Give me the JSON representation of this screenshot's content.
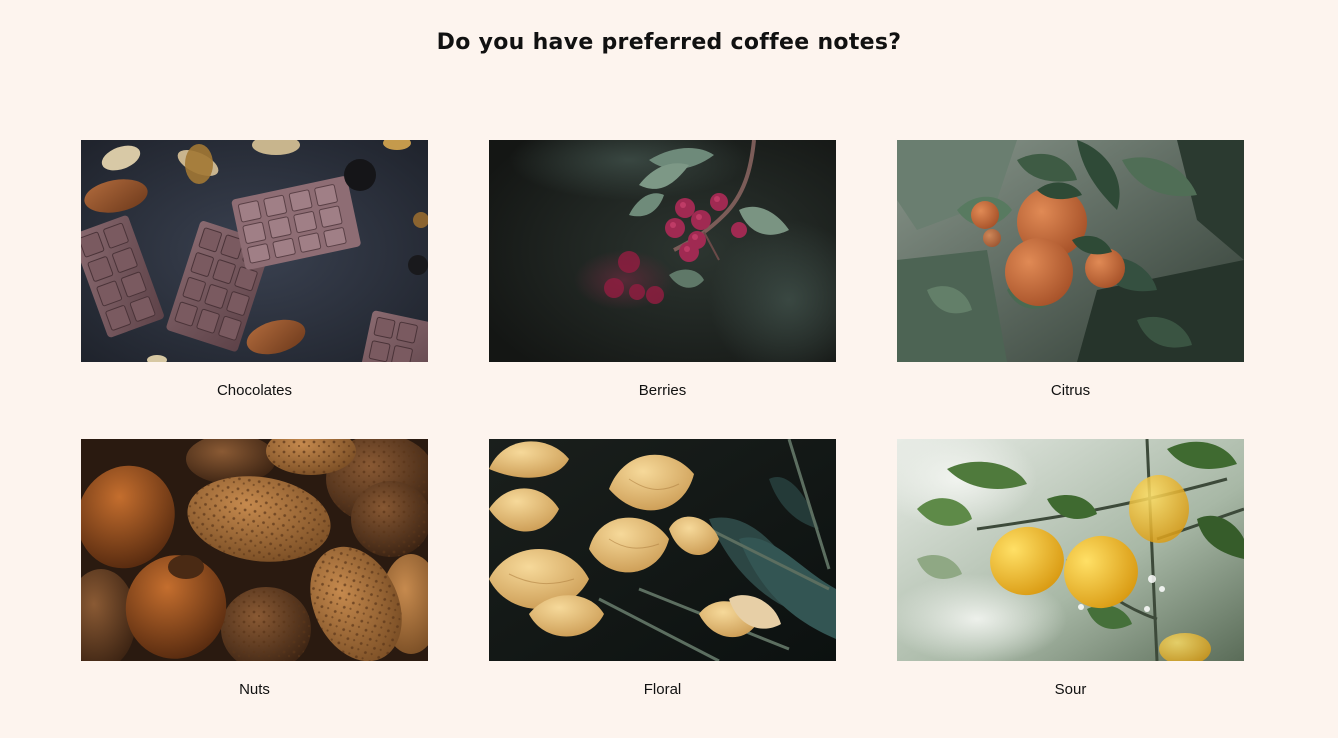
{
  "heading": "Do you have preferred coffee notes?",
  "notes": [
    {
      "label": "Chocolates",
      "image": "chocolate-bars-with-almonds-photo"
    },
    {
      "label": "Berries",
      "image": "red-berries-on-branch-photo"
    },
    {
      "label": "Citrus",
      "image": "oranges-on-tree-photo"
    },
    {
      "label": "Nuts",
      "image": "almonds-and-hazelnuts-photo"
    },
    {
      "label": "Floral",
      "image": "yellow-tulips-photo"
    },
    {
      "label": "Sour",
      "image": "lemons-on-tree-photo"
    }
  ],
  "colors": {
    "background": "#fdf4ee",
    "text": "#111111"
  }
}
